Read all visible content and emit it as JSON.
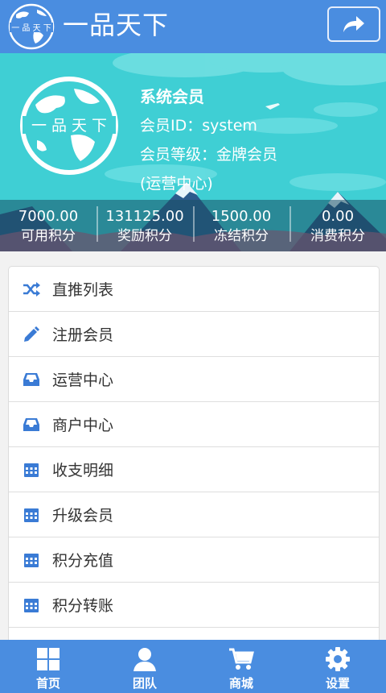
{
  "header": {
    "title": "一品天下",
    "logo_text": "一 品 天 下",
    "share_icon": "share-icon"
  },
  "profile": {
    "logo_text": "一 品 天 下",
    "member_type": "系统会员",
    "member_id": "会员ID：system",
    "member_level": "会员等级：金牌会员",
    "center": "(运营中心)"
  },
  "stats": [
    {
      "value": "7000.00",
      "label": "可用积分"
    },
    {
      "value": "131125.00",
      "label": "奖励积分"
    },
    {
      "value": "1500.00",
      "label": "冻结积分"
    },
    {
      "value": "0.00",
      "label": "消费积分"
    }
  ],
  "menu": [
    {
      "label": "直推列表",
      "icon": "shuffle-icon"
    },
    {
      "label": "注册会员",
      "icon": "pencil-icon"
    },
    {
      "label": "运营中心",
      "icon": "inbox-icon"
    },
    {
      "label": "商户中心",
      "icon": "inbox-icon"
    },
    {
      "label": "收支明细",
      "icon": "calendar-icon"
    },
    {
      "label": "升级会员",
      "icon": "calendar-icon"
    },
    {
      "label": "积分充值",
      "icon": "calendar-icon"
    },
    {
      "label": "积分转账",
      "icon": "calendar-icon"
    }
  ],
  "nav": [
    {
      "label": "首页",
      "icon": "grid-icon"
    },
    {
      "label": "团队",
      "icon": "user-icon"
    },
    {
      "label": "商城",
      "icon": "cart-icon"
    },
    {
      "label": "设置",
      "icon": "gear-icon"
    }
  ],
  "colors": {
    "primary": "#4a8de0",
    "banner": "#3fcfd4",
    "icon": "#3a7bd5"
  }
}
